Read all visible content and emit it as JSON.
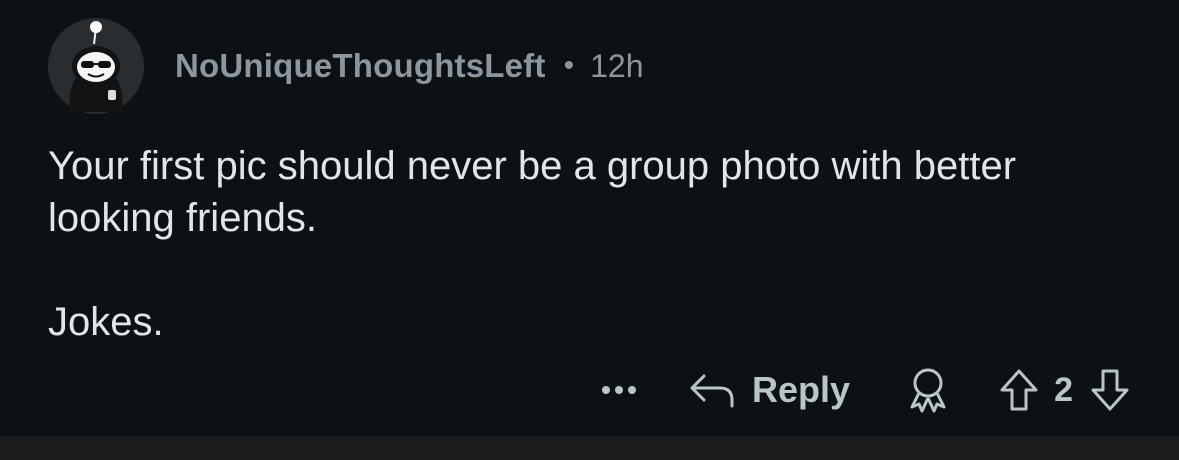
{
  "comment": {
    "username": "NoUniqueThoughtsLeft",
    "separator": "•",
    "timestamp": "12h",
    "paragraphs": [
      "Your first pic should never be a group photo with better looking friends.",
      "Jokes."
    ]
  },
  "actions": {
    "reply_label": "Reply",
    "vote_count": "2"
  },
  "colors": {
    "background": "#0e1113",
    "meta_text": "#8b969e",
    "body_text": "#e3e6e8",
    "action_text": "#b8c5c9"
  },
  "icons": {
    "avatar": "snoo-avatar-icon",
    "more": "more-options-icon",
    "reply": "reply-arrow-icon",
    "award": "award-icon",
    "upvote": "upvote-arrow-icon",
    "downvote": "downvote-arrow-icon"
  }
}
